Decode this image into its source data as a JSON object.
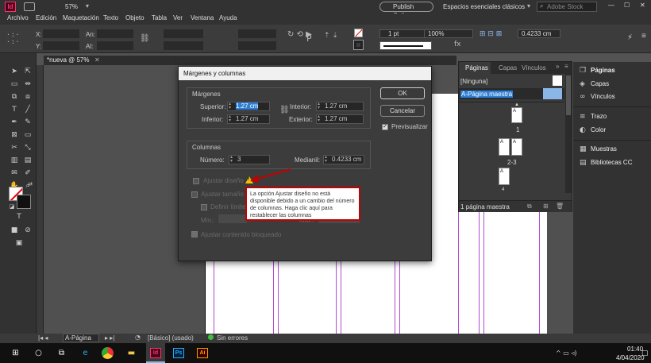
{
  "app": {
    "logo": "Id",
    "zoom": "57%",
    "publish_label": "Publish Online",
    "workspace": "Espacios esenciales clásicos",
    "search_placeholder": "Adobe Stock"
  },
  "menu": [
    "Archivo",
    "Edición",
    "Maquetación",
    "Texto",
    "Objeto",
    "Tabla",
    "Ver",
    "Ventana",
    "Ayuda"
  ],
  "control": {
    "x_label": "X:",
    "y_label": "Y:",
    "w_label": "An:",
    "h_label": "Al:",
    "stroke_weight": "1 pt",
    "scale": "100%",
    "spacing": "0.4233 cm"
  },
  "document": {
    "tab_label": "*nueva @ 57%"
  },
  "dialog": {
    "title": "Márgenes y columnas",
    "margins_heading": "Márgenes",
    "top_label": "Superior:",
    "top_value": "1.27 cm",
    "bottom_label": "Inferior:",
    "bottom_value": "1.27 cm",
    "inside_label": "Interior:",
    "inside_value": "1.27 cm",
    "outside_label": "Exterior:",
    "outside_value": "1.27 cm",
    "columns_heading": "Columnas",
    "number_label": "Número:",
    "number_value": "3",
    "gutter_label": "Medianil:",
    "gutter_value": "0.4233 cm",
    "adjust_layout": "Ajustar diseño",
    "adjust_size": "Ajustar tamaño",
    "define_limits": "Definir límite",
    "min_label": "Mín.:",
    "max_label": "Máx.:",
    "adjust_locked": "Ajustar contenido bloqueado",
    "ok": "OK",
    "cancel": "Cancelar",
    "preview": "Previsualizar",
    "tooltip": "La opción Ajustar diseño no está disponible debido a un cambio del número de columnas. Haga clic aquí para restablecer las columnas"
  },
  "pages_panel": {
    "tabs": [
      "Páginas",
      "Capas",
      "Vínculos"
    ],
    "none_label": "[Ninguna]",
    "master_label": "A-Página maestra",
    "page1": "1",
    "spread": "2-3",
    "page4": "4",
    "thumb_letter": "A",
    "footer": "1 página maestra"
  },
  "dock": [
    {
      "label": "Páginas",
      "icon": "pages-icon"
    },
    {
      "label": "Capas",
      "icon": "layers-icon"
    },
    {
      "label": "Vínculos",
      "icon": "links-icon"
    },
    {
      "label": "Trazo",
      "icon": "stroke-icon"
    },
    {
      "label": "Color",
      "icon": "color-icon"
    },
    {
      "label": "Muestras",
      "icon": "swatches-icon"
    },
    {
      "label": "Bibliotecas CC",
      "icon": "cc-libraries-icon"
    }
  ],
  "status": {
    "page_select": "A-Página maes",
    "style": "[Básico] (usado)",
    "errors": "Sin errores"
  },
  "taskbar": {
    "time": "01:40",
    "date": "4/04/2020",
    "apps": [
      "Id",
      "Ps",
      "Ai"
    ]
  },
  "colors": {
    "indesign": "#ff3366",
    "accent_red": "#c40000",
    "guide": "#b14bd0",
    "selection": "#2d7fd6"
  }
}
